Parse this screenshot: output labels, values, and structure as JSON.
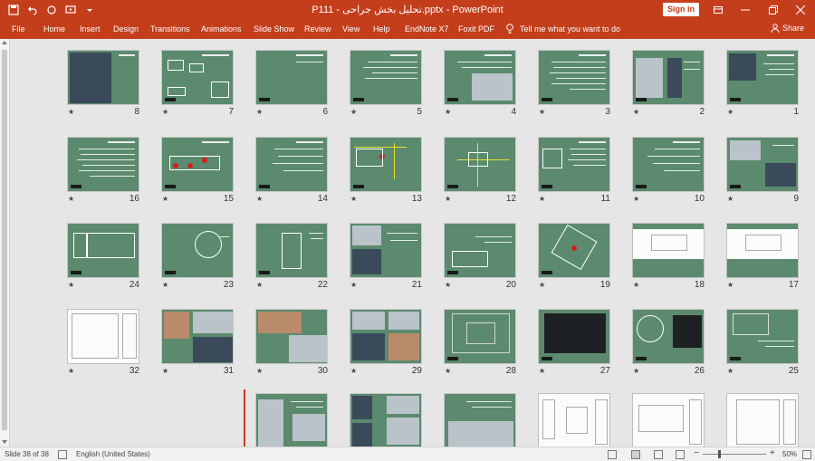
{
  "window": {
    "title": "P111 - تحلیل بخش جراحی.pptx  -  PowerPoint",
    "signin_label": "Sign in"
  },
  "ribbon": {
    "tabs": [
      "File",
      "Home",
      "Insert",
      "Design",
      "Transitions",
      "Animations",
      "Slide Show",
      "Review",
      "View",
      "Help",
      "EndNote X7",
      "Foxit PDF"
    ],
    "tell_me": "Tell me what you want to do",
    "share_label": "Share"
  },
  "slides": [
    {
      "n": "1"
    },
    {
      "n": "2"
    },
    {
      "n": "3"
    },
    {
      "n": "4"
    },
    {
      "n": "5"
    },
    {
      "n": "6"
    },
    {
      "n": "7"
    },
    {
      "n": "8"
    },
    {
      "n": "9"
    },
    {
      "n": "10"
    },
    {
      "n": "11"
    },
    {
      "n": "12"
    },
    {
      "n": "13"
    },
    {
      "n": "14"
    },
    {
      "n": "15"
    },
    {
      "n": "16"
    },
    {
      "n": "17"
    },
    {
      "n": "18"
    },
    {
      "n": "19"
    },
    {
      "n": "20"
    },
    {
      "n": "21"
    },
    {
      "n": "22"
    },
    {
      "n": "23"
    },
    {
      "n": "24"
    },
    {
      "n": "25"
    },
    {
      "n": "26"
    },
    {
      "n": "27"
    },
    {
      "n": "28"
    },
    {
      "n": "29"
    },
    {
      "n": "30"
    },
    {
      "n": "31"
    },
    {
      "n": "32"
    }
  ],
  "status": {
    "slide_info": "Slide 38 of 38",
    "language": "English (United States)",
    "zoom": "50%"
  },
  "colors": {
    "accent": "#c43e1c",
    "slide_green": "#5b8a6e"
  }
}
